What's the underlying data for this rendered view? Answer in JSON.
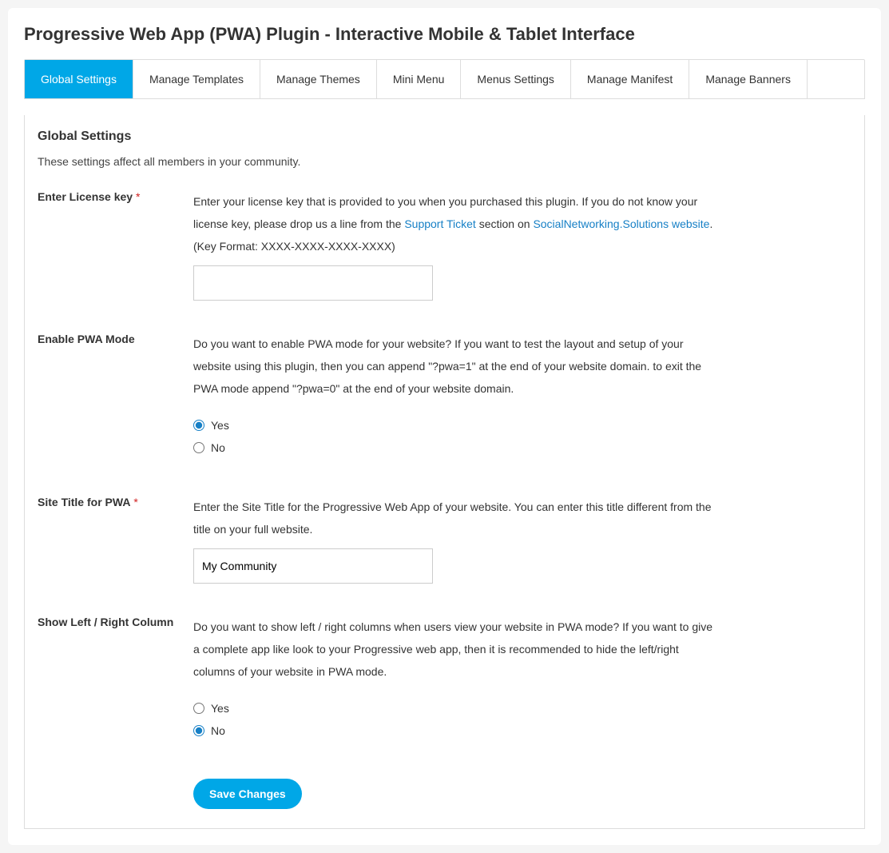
{
  "page": {
    "title": "Progressive Web App (PWA) Plugin - Interactive Mobile & Tablet Interface"
  },
  "tabs": [
    {
      "label": "Global Settings",
      "active": true
    },
    {
      "label": "Manage Templates"
    },
    {
      "label": "Manage Themes"
    },
    {
      "label": "Mini Menu"
    },
    {
      "label": "Menus Settings"
    },
    {
      "label": "Manage Manifest"
    },
    {
      "label": "Manage Banners"
    }
  ],
  "panel": {
    "title": "Global Settings",
    "desc": "These settings affect all members in your community."
  },
  "fields": {
    "license": {
      "label": "Enter License key",
      "required": "*",
      "desc_a": "Enter your license key that is provided to you when you purchased this plugin. If you do not know your license key, please drop us a line from the ",
      "link1": "Support Ticket",
      "desc_b": " section on ",
      "link2": "SocialNetworking.Solutions website",
      "desc_c": ". (Key Format: XXXX-XXXX-XXXX-XXXX)",
      "value": ""
    },
    "pwa_mode": {
      "label": "Enable PWA Mode",
      "desc": "Do you want to enable PWA mode for your website? If you want to test the layout and setup of your website using this plugin, then you can append \"?pwa=1\" at the end of your website domain. to exit the PWA mode append \"?pwa=0\" at the end of your website domain.",
      "yes": "Yes",
      "no": "No",
      "selected": "yes"
    },
    "site_title": {
      "label": "Site Title for PWA",
      "required": "*",
      "desc": "Enter the Site Title for the Progressive Web App of your website. You can enter this title different from the title on your full website.",
      "value": "My Community"
    },
    "columns": {
      "label": "Show Left / Right Column",
      "desc": "Do you want to show left / right columns when users view your website in PWA mode? If you want to give a complete app like look to your Progressive web app, then it is recommended to hide the left/right columns of your website in PWA mode.",
      "yes": "Yes",
      "no": "No",
      "selected": "no"
    }
  },
  "actions": {
    "save": "Save Changes"
  }
}
